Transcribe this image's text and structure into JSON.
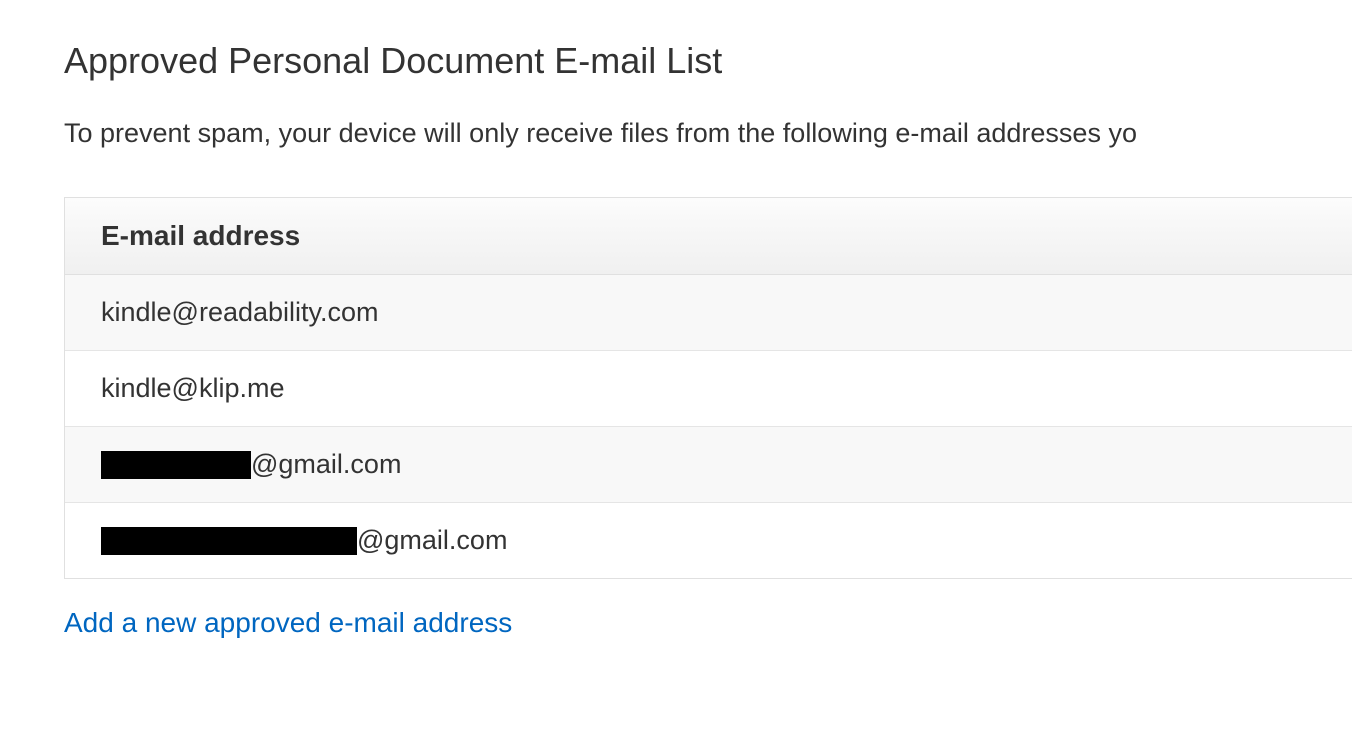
{
  "section": {
    "title": "Approved Personal Document E-mail List",
    "description": "To prevent spam, your device will only receive files from the following e-mail addresses yo"
  },
  "table": {
    "header": "E-mail address",
    "rows": [
      {
        "email": "kindle@readability.com",
        "redacted": false
      },
      {
        "email": "kindle@klip.me",
        "redacted": false
      },
      {
        "email": "@gmail.com",
        "redacted": true,
        "redactClass": "redacted-1"
      },
      {
        "email": "@gmail.com",
        "redacted": true,
        "redactClass": "redacted-2"
      }
    ]
  },
  "addLink": {
    "label": "Add a new approved e-mail address"
  }
}
